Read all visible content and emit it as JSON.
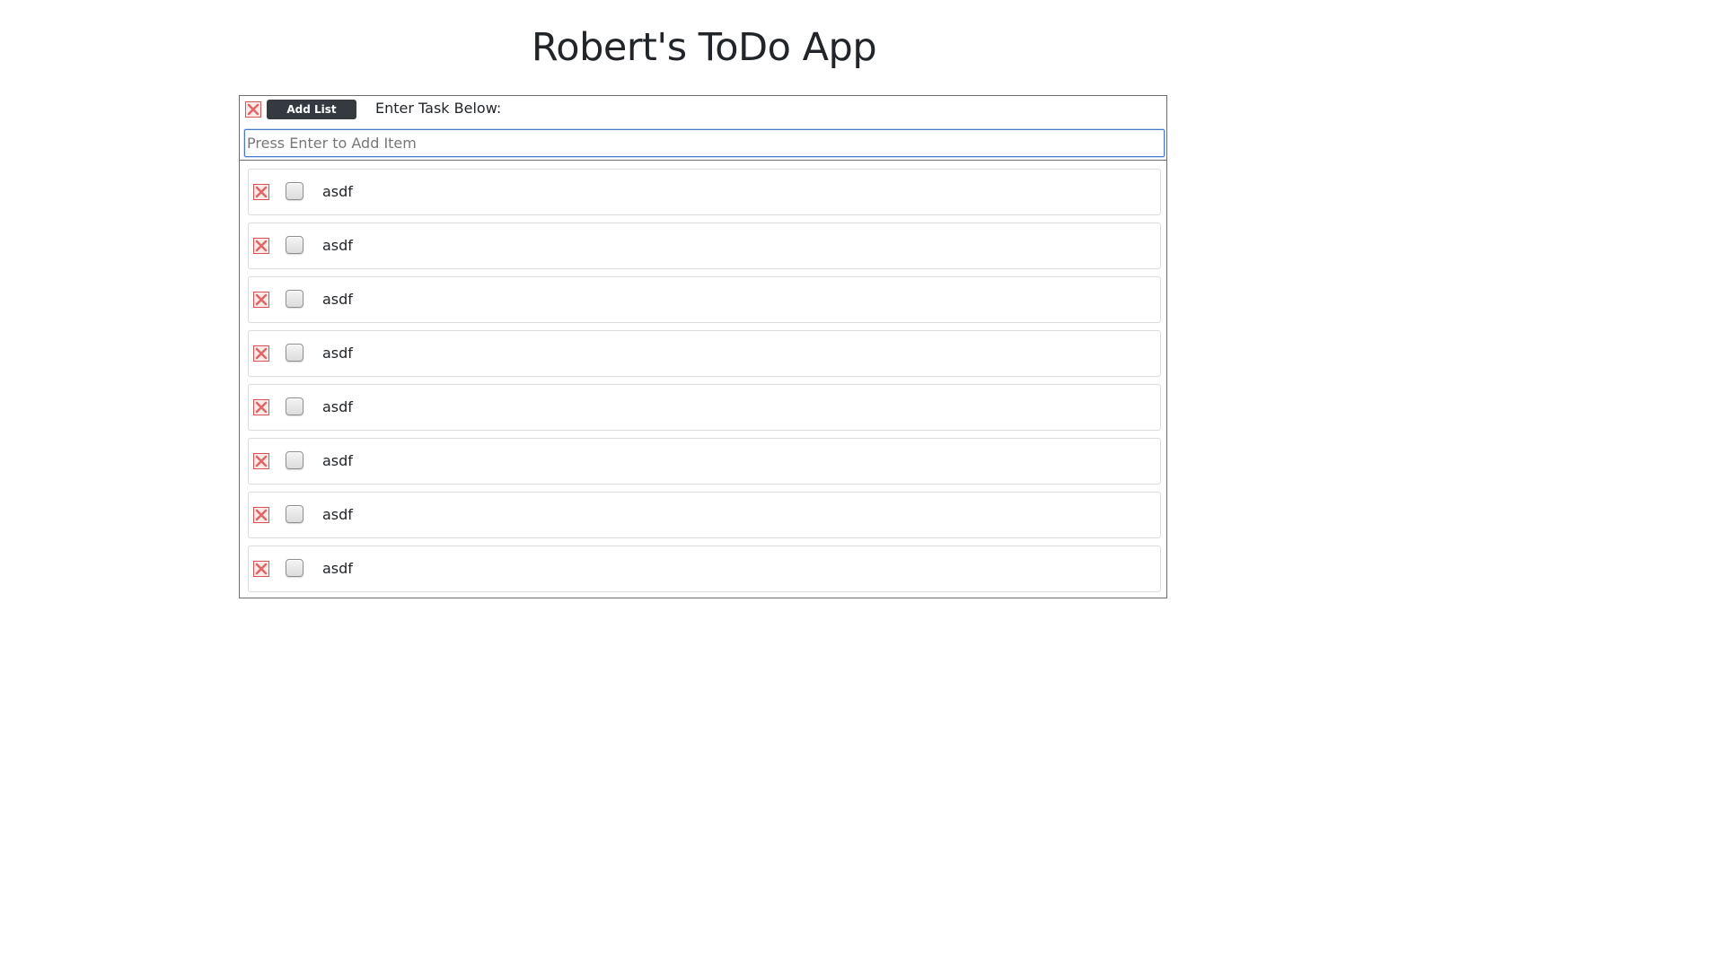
{
  "page": {
    "title": "Robert's ToDo App"
  },
  "header": {
    "delete_icon": "close-x-icon",
    "add_list_label": "Add List",
    "enter_task_label": "Enter Task Below:"
  },
  "input": {
    "value": "",
    "placeholder": "Press Enter to Add Item"
  },
  "tasks": [
    {
      "text": "asdf",
      "checked": false
    },
    {
      "text": "asdf",
      "checked": false
    },
    {
      "text": "asdf",
      "checked": false
    },
    {
      "text": "asdf",
      "checked": false
    },
    {
      "text": "asdf",
      "checked": false
    },
    {
      "text": "asdf",
      "checked": false
    },
    {
      "text": "asdf",
      "checked": false
    },
    {
      "text": "asdf",
      "checked": false
    }
  ],
  "colors": {
    "accent_dark": "#343a40",
    "delete_red": "#d9534f",
    "focus_blue": "#4a78c8"
  }
}
